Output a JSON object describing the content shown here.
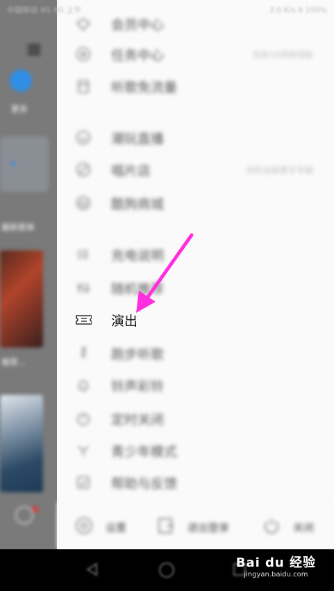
{
  "status_bar": {
    "left": "中国移动 4G 4G 上午",
    "right": "3.0 K/s 8 100%"
  },
  "background_app": {
    "label": "更多",
    "section": "最新歌单",
    "card_text": "推荐..."
  },
  "drawer": {
    "items": [
      {
        "label": "会员中心",
        "hint": "",
        "icon": "diamond-icon"
      },
      {
        "label": "任务中心",
        "hint": "您有10项待领取",
        "icon": "task-icon"
      },
      {
        "label": "听歌免流量",
        "hint": "",
        "icon": "sim-card-icon"
      },
      {
        "label": "潮玩直播",
        "hint": "",
        "icon": "live-icon"
      },
      {
        "label": "唱片店",
        "hint": "你的全新数字专辑",
        "icon": "vinyl-icon"
      },
      {
        "label": "酷狗商城",
        "hint": "",
        "icon": "shop-icon"
      },
      {
        "label": "充电说明",
        "hint": "",
        "icon": "list-icon"
      },
      {
        "label": "随机推荐",
        "hint": "",
        "icon": "equalizer-icon"
      },
      {
        "label": "演出",
        "hint": "",
        "icon": "ticket-icon"
      },
      {
        "label": "跑步听歌",
        "hint": "",
        "icon": "running-icon"
      },
      {
        "label": "铃声彩铃",
        "hint": "",
        "icon": "bell-icon"
      },
      {
        "label": "定时关闭",
        "hint": "",
        "icon": "timer-icon"
      },
      {
        "label": "青少年模式",
        "hint": "",
        "icon": "youth-icon"
      },
      {
        "label": "帮助与反馈",
        "hint": "",
        "icon": "help-icon"
      }
    ],
    "bottom": {
      "settings": "设置",
      "logout": "退出登录",
      "close": "关闭"
    }
  },
  "watermark": {
    "brand": "Bai du 经验",
    "url": "jingyan.baidu.com"
  },
  "colors": {
    "arrow": "#ff2fe0",
    "drawer_bg": "#fafafa"
  }
}
